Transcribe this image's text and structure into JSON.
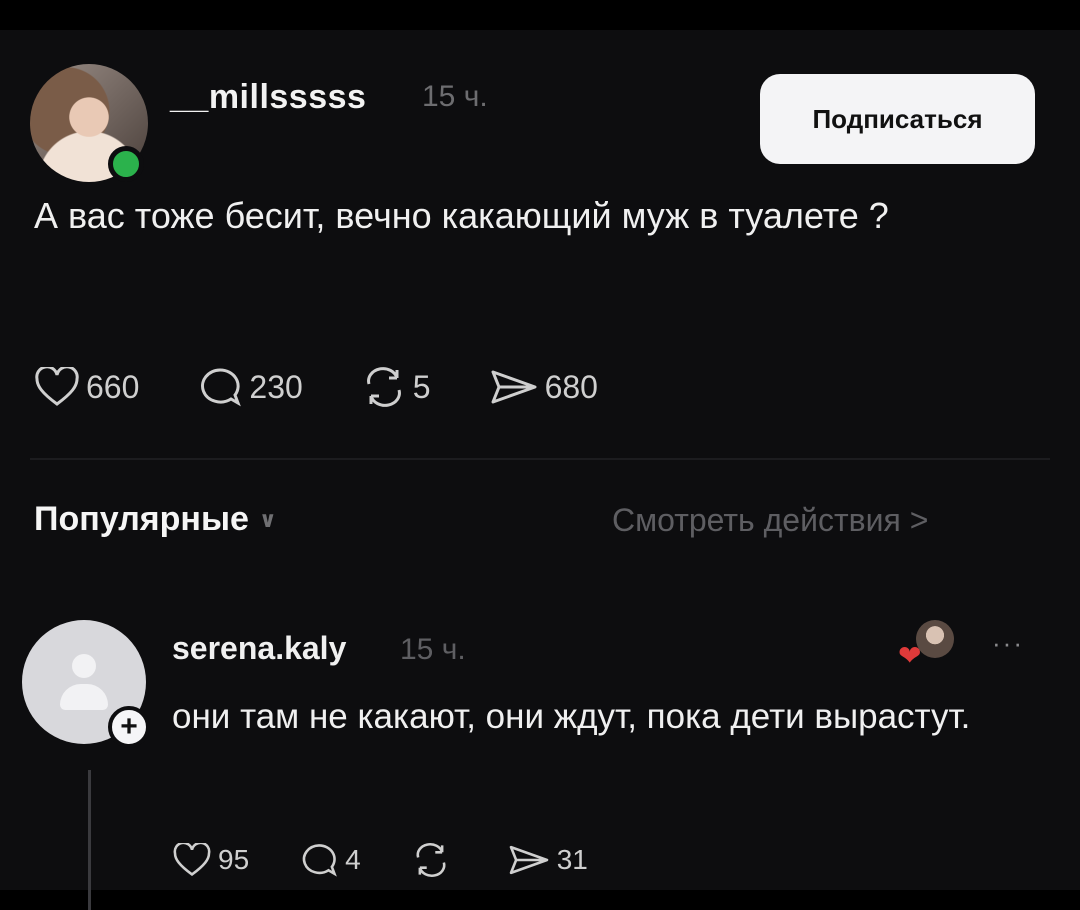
{
  "post": {
    "username": "__millsssss",
    "time": "15 ч.",
    "subscribe_label": "Подписаться",
    "text": "А вас тоже бесит, вечно какающий муж в туалете ?",
    "likes": "660",
    "comments": "230",
    "reposts": "5",
    "shares": "680"
  },
  "sort": {
    "label": "Популярные",
    "view_actions": "Смотреть действия >"
  },
  "comment": {
    "username": "serena.kaly",
    "time": "15 ч.",
    "text": "они там не какают, они ждут, пока дети вырастут.",
    "likes": "95",
    "comments": "4",
    "reposts": "",
    "shares": "31",
    "more": "···"
  },
  "colors": {
    "background": "#0d0d0f",
    "online": "#2bb24c",
    "heart": "#e03a3a"
  },
  "icons": [
    "heart-icon",
    "comment-icon",
    "repost-icon",
    "share-icon",
    "chevron-down-icon",
    "plus-icon"
  ]
}
